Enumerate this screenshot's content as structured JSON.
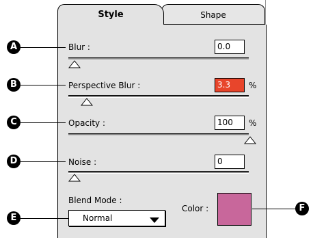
{
  "tabs": {
    "active": "Style",
    "inactive": "Shape"
  },
  "controls": {
    "blur": {
      "label": "Blur :",
      "value": "0.0",
      "unit": "",
      "slider_fraction": 0.0
    },
    "perspective_blur": {
      "label": "Perspective Blur :",
      "value": "3.3",
      "unit": "%",
      "slider_fraction": 0.08
    },
    "opacity": {
      "label": "Opacity :",
      "value": "100",
      "unit": "%",
      "slider_fraction": 1.0
    },
    "noise": {
      "label": "Noise :",
      "value": "0",
      "unit": "",
      "slider_fraction": 0.0
    }
  },
  "blend_mode": {
    "label": "Blend Mode :",
    "value": "Normal"
  },
  "color": {
    "label": "Color :",
    "swatch": "#c8679b"
  },
  "callouts": [
    "A",
    "B",
    "C",
    "D",
    "E",
    "F"
  ],
  "colors": {
    "highlight": "#e8452b",
    "panel": "#e3e3e3"
  }
}
